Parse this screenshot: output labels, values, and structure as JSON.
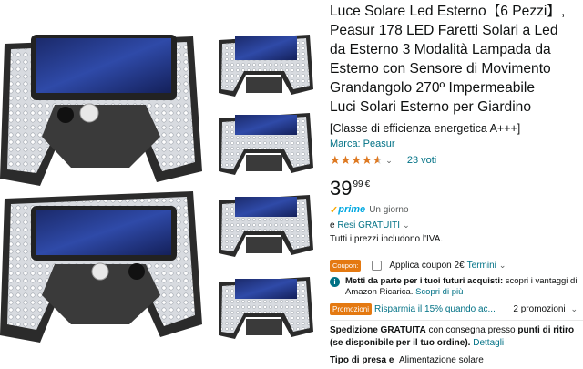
{
  "product": {
    "title_lines": [
      "Luce Solare Led Esterno【6 Pezzi】,",
      "Peasur 178 LED Faretti Solari a Led",
      "da Esterno 3 Modalità Lampada da",
      "Esterno con Sensore di Movimento",
      "Grandangolo 270º Impermeabile",
      "Luci Solari Esterno per Giardino"
    ],
    "energy_class": "[Classe di efficienza energetica A+++]",
    "brand": "Marca: Peasur",
    "rating": 4.6,
    "reviews": "23 voti",
    "price_whole": "39",
    "price_decimal": "99",
    "price_currency": "€",
    "prime_logo": "prime",
    "prime_delivery": "Un giorno",
    "returns_prefix": "e",
    "returns_link": "Resi GRATUITI",
    "returns_chevron": "⌄",
    "vat_note": "Tutti i prezzi includono l'IVA.",
    "coupon_badge": "Coupon:",
    "coupon_label": "Applica coupon 2€",
    "coupon_link": "Termini",
    "coupon_chevron": "⌄",
    "ricarica_bold": "Metti da parte per i tuoi futuri acquisti:",
    "ricarica_text": "scopri i vantaggi di Amazon Ricarica.",
    "ricarica_link": "Scopri di più",
    "promo_badge": "Promozioni",
    "promo_text": "Risparmia il 15% quando ac...",
    "promo_count": "2 promozioni",
    "promo_chevron": "⌄",
    "shipping_bold": "Spedizione GRATUITA",
    "shipping_text": "con consegna presso",
    "shipping_bold2": "punti di ritiro",
    "shipping_bold3": "(se disponibile per il tuo ordine).",
    "shipping_link": "Dettagli",
    "spec_key": "Tipo di presa e",
    "spec_value": "Alimentazione solare"
  },
  "icons": {
    "star": "★",
    "info": "i",
    "check": "✓"
  },
  "colors": {
    "link": "#007185",
    "star": "#de7921",
    "badge": "#e47911",
    "prime": "#00a8e1"
  }
}
